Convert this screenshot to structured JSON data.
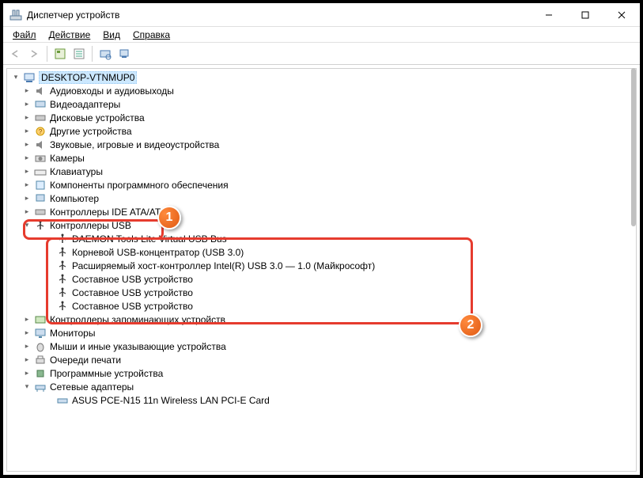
{
  "window": {
    "title": "Диспетчер устройств"
  },
  "menu": {
    "file": "Файл",
    "action": "Действие",
    "view": "Вид",
    "help": "Справка"
  },
  "tree": {
    "root": "DESKTOP-VTNMUP0",
    "categories": [
      "Аудиовходы и аудиовыходы",
      "Видеоадаптеры",
      "Дисковые устройства",
      "Другие устройства",
      "Звуковые, игровые и видеоустройства",
      "Камеры",
      "Клавиатуры",
      "Компоненты программного обеспечения",
      "Компьютер",
      "Контроллеры IDE ATA/ATAPI",
      "Контроллеры USB",
      "Контроллеры запоминающих устройств",
      "Мониторы",
      "Мыши и иные указывающие устройства",
      "Очереди печати",
      "Программные устройства",
      "Сетевые адаптеры"
    ],
    "usb_children": [
      "DAEMON Tools Lite Virtual USB Bus",
      "Корневой USB-концентратор (USB 3.0)",
      "Расширяемый хост-контроллер Intel(R) USB 3.0 — 1.0 (Майкрософт)",
      "Составное USB устройство",
      "Составное USB устройство",
      "Составное USB устройство"
    ],
    "net_children": [
      "ASUS PCE-N15 11n Wireless LAN PCI-E Card"
    ]
  },
  "callouts": {
    "one": "1",
    "two": "2"
  }
}
